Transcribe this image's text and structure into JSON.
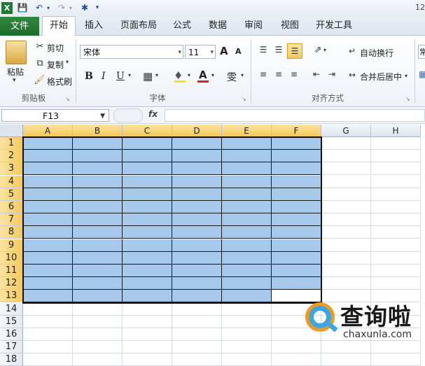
{
  "qat": {
    "title_fragment": "12"
  },
  "tabs": {
    "file": "文件",
    "items": [
      "开始",
      "插入",
      "页面布局",
      "公式",
      "数据",
      "审阅",
      "视图",
      "开发工具"
    ],
    "active": "开始"
  },
  "ribbon": {
    "clipboard": {
      "paste": "粘贴",
      "cut": "剪切",
      "copy": "复制",
      "format_painter": "格式刷",
      "label": "剪贴板"
    },
    "font": {
      "name": "宋体",
      "size": "11",
      "bold": "B",
      "italic": "I",
      "underline": "U",
      "font_color_glyph": "A",
      "grow_glyph": "A",
      "shrink_glyph": "A",
      "phonetic_glyph": "雯",
      "label": "字体"
    },
    "alignment": {
      "wrap": "自动换行",
      "merge": "合并后居中",
      "label": "对齐方式"
    },
    "number": {
      "fragment": "常"
    }
  },
  "formula_bar": {
    "name_box": "F13",
    "fx": "fx",
    "value": ""
  },
  "sheet": {
    "columns": [
      "A",
      "B",
      "C",
      "D",
      "E",
      "F",
      "G",
      "H"
    ],
    "rows": [
      "1",
      "2",
      "3",
      "4",
      "5",
      "6",
      "7",
      "8",
      "9",
      "10",
      "11",
      "12",
      "13",
      "14",
      "15",
      "16",
      "17",
      "18"
    ],
    "selected_columns": [
      "A",
      "B",
      "C",
      "D",
      "E",
      "F"
    ],
    "selected_rows_through": 13,
    "fill_color": "#a6c8ea",
    "active_cell": "F13"
  },
  "watermark": {
    "brand": "查询啦",
    "url": "chaxunla.com"
  },
  "colors": {
    "file_tab": "#1d6b2a",
    "selection_header": "#f4c95b",
    "accent_blue": "#3aa6e3",
    "accent_orange": "#f29a20"
  }
}
